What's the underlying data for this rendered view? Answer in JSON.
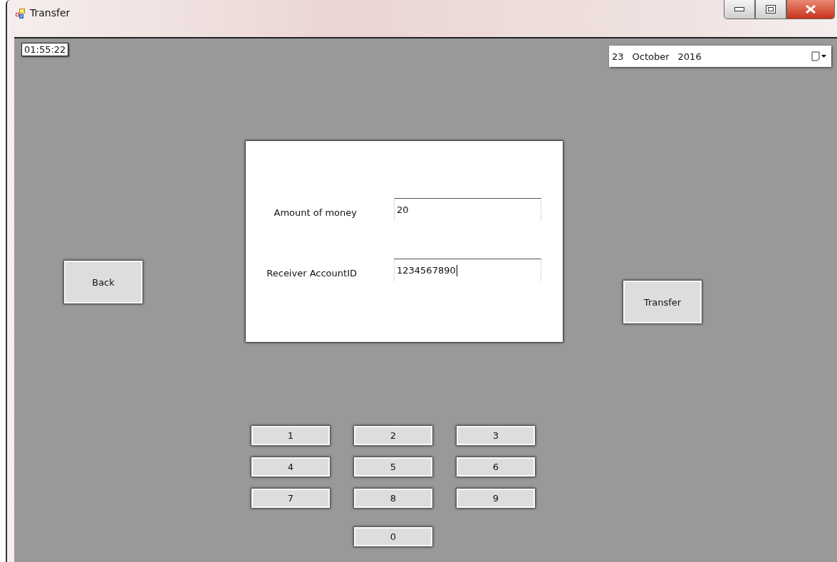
{
  "window": {
    "title": "Transfer"
  },
  "clock": "01:55:22",
  "date_picker": {
    "day": "23",
    "month": "October",
    "year": "2016"
  },
  "form": {
    "fields": [
      {
        "label": "Amount of money",
        "value": "20",
        "focused": false
      },
      {
        "label": "Receiver AccountID",
        "value": "1234567890",
        "focused": true
      }
    ]
  },
  "buttons": {
    "back": "Back",
    "transfer": "Transfer"
  },
  "keypad": [
    "1",
    "2",
    "3",
    "4",
    "5",
    "6",
    "7",
    "8",
    "9",
    "0"
  ]
}
